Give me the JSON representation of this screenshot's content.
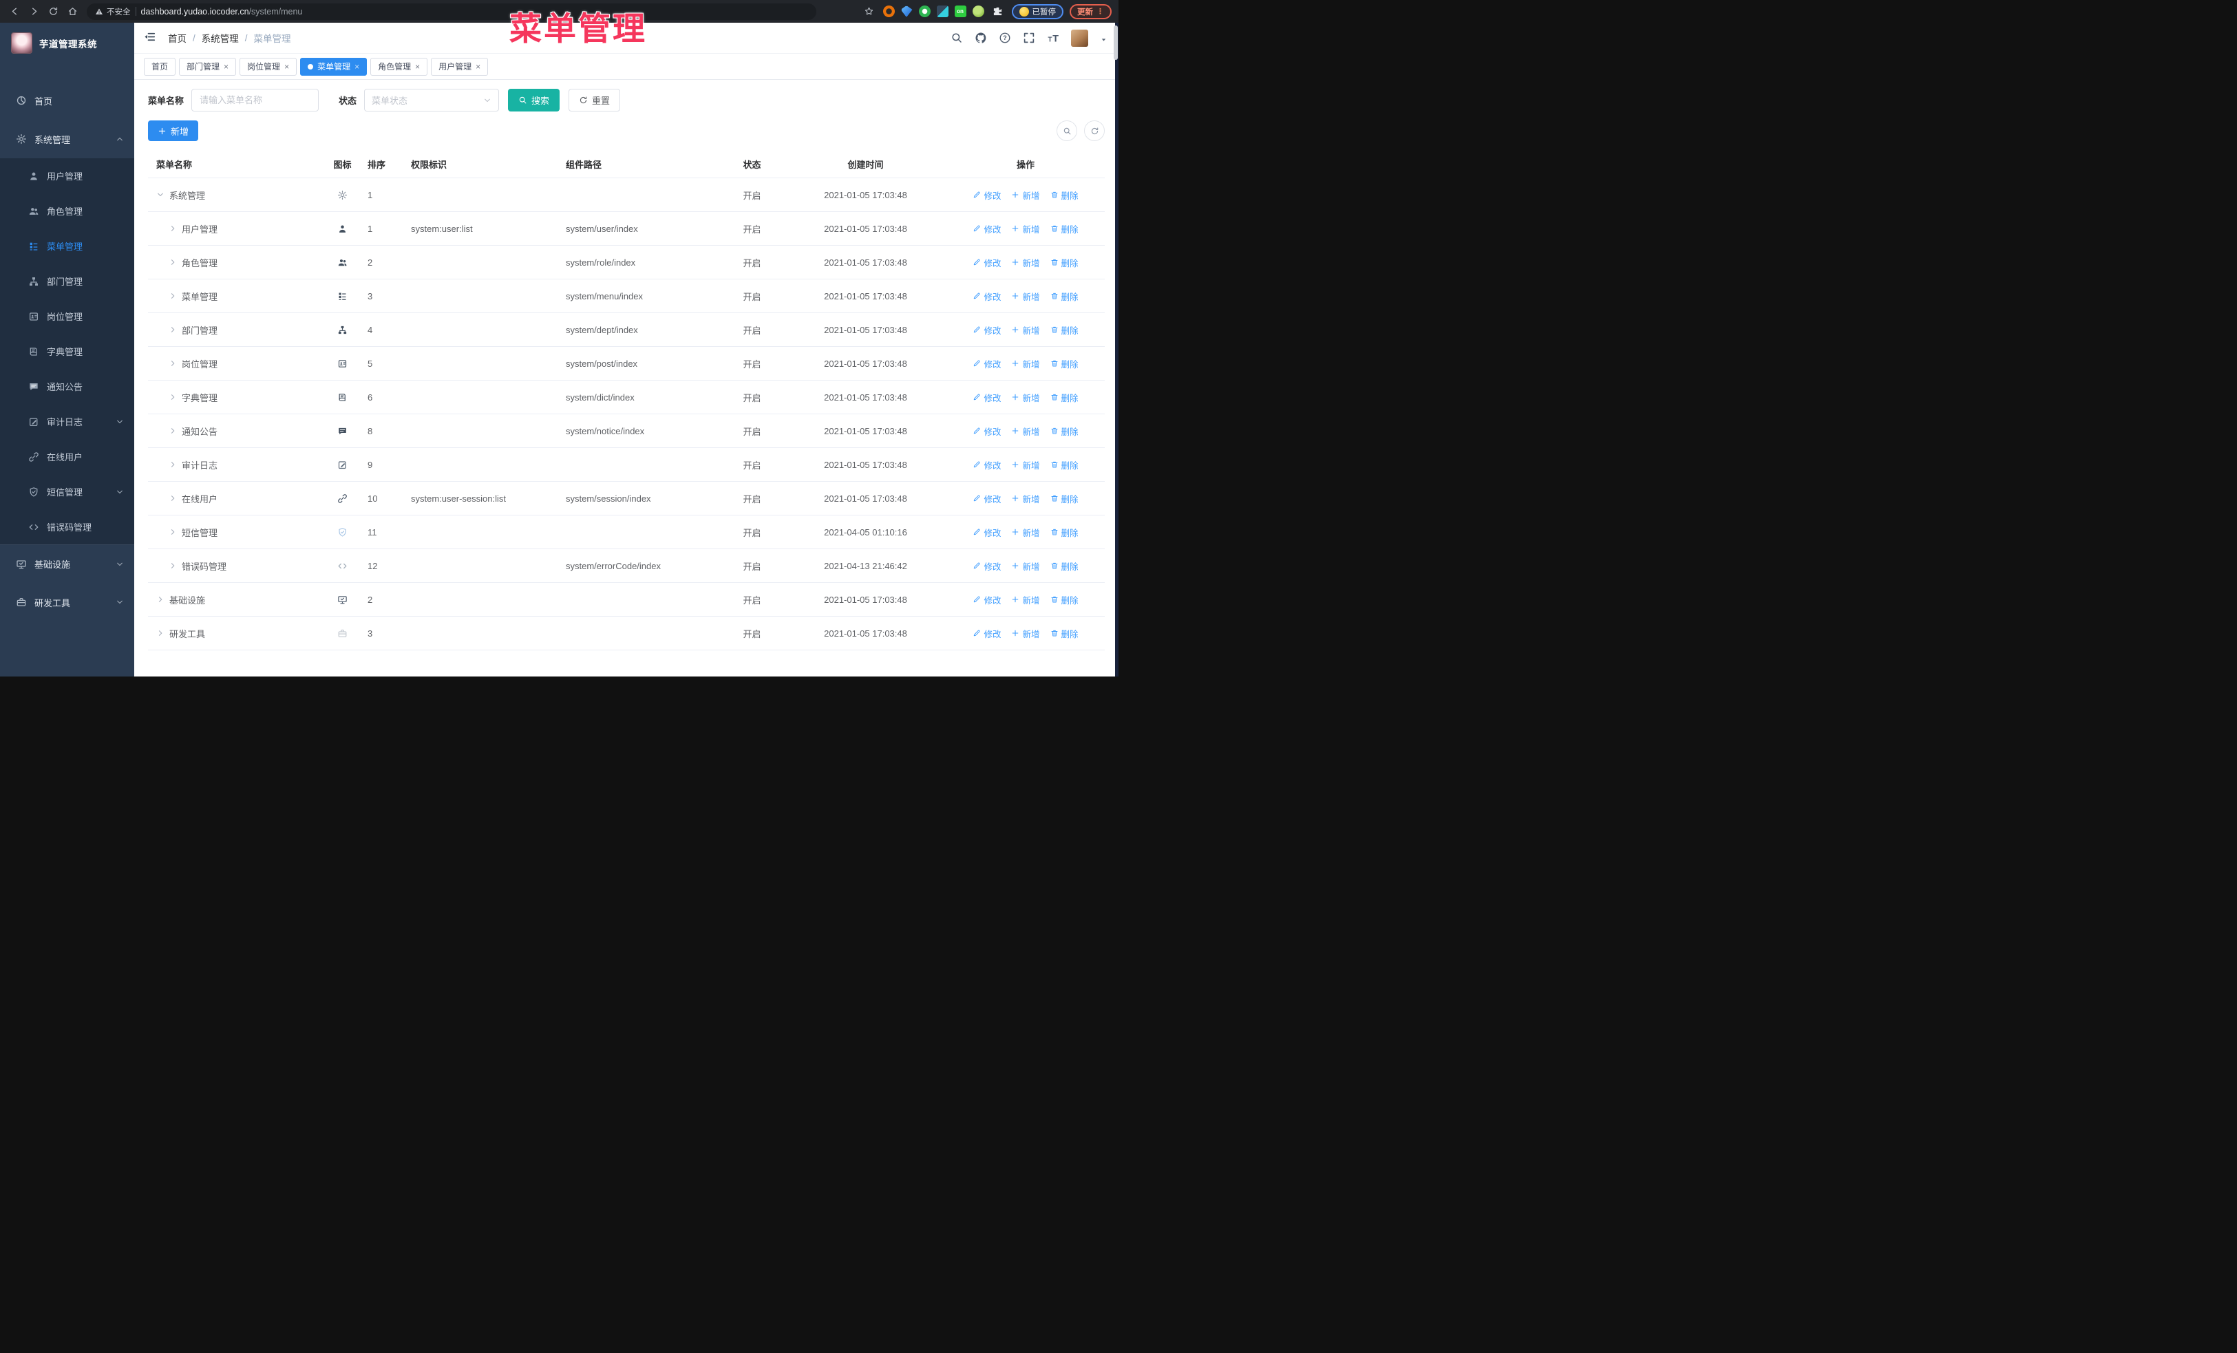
{
  "overlay": {
    "title": "菜单管理"
  },
  "browser": {
    "security_label": "不安全",
    "url_host": "dashboard.yudao.iocoder.cn",
    "url_path": "/system/menu",
    "paused_label": "已暂停",
    "update_label": "更新",
    "update_dots": "⋮"
  },
  "sidebar": {
    "app_title": "芋道管理系统",
    "items": [
      {
        "label": "首页",
        "icon": "#i-dashboard",
        "type": "top"
      },
      {
        "label": "系统管理",
        "icon": "#i-gear",
        "type": "top",
        "chevron": "up"
      },
      {
        "label": "用户管理",
        "icon": "#i-user",
        "type": "sub"
      },
      {
        "label": "角色管理",
        "icon": "#i-users",
        "type": "sub"
      },
      {
        "label": "菜单管理",
        "icon": "#i-menu",
        "type": "sub",
        "active": true
      },
      {
        "label": "部门管理",
        "icon": "#i-tree",
        "type": "sub"
      },
      {
        "label": "岗位管理",
        "icon": "#i-badge",
        "type": "sub"
      },
      {
        "label": "字典管理",
        "icon": "#i-book",
        "type": "sub"
      },
      {
        "label": "通知公告",
        "icon": "#i-message",
        "type": "sub"
      },
      {
        "label": "审计日志",
        "icon": "#i-edit",
        "type": "sub",
        "chevron": "down"
      },
      {
        "label": "在线用户",
        "icon": "#i-link",
        "type": "sub"
      },
      {
        "label": "短信管理",
        "icon": "#i-shield",
        "type": "sub",
        "chevron": "down"
      },
      {
        "label": "错误码管理",
        "icon": "#i-code",
        "type": "sub"
      },
      {
        "label": "基础设施",
        "icon": "#i-monitor",
        "type": "top",
        "chevron": "down",
        "divider": true
      },
      {
        "label": "研发工具",
        "icon": "#i-tool",
        "type": "top",
        "chevron": "down"
      }
    ]
  },
  "header": {
    "breadcrumb": [
      "首页",
      "系统管理",
      "菜单管理"
    ],
    "sep": "/"
  },
  "tabs": {
    "close_glyph": "×",
    "items": [
      {
        "label": "首页",
        "closable": false
      },
      {
        "label": "部门管理",
        "closable": true
      },
      {
        "label": "岗位管理",
        "closable": true
      },
      {
        "label": "菜单管理",
        "closable": true,
        "active": true
      },
      {
        "label": "角色管理",
        "closable": true
      },
      {
        "label": "用户管理",
        "closable": true
      }
    ]
  },
  "filters": {
    "name_label": "菜单名称",
    "name_placeholder": "请输入菜单名称",
    "status_label": "状态",
    "status_placeholder": "菜单状态",
    "search_label": "搜索",
    "reset_label": "重置",
    "add_label": "新增"
  },
  "table": {
    "columns": [
      "菜单名称",
      "图标",
      "排序",
      "权限标识",
      "组件路径",
      "状态",
      "创建时间",
      "操作"
    ],
    "actions": {
      "edit": "修改",
      "add": "新增",
      "delete": "删除"
    },
    "rows": [
      {
        "name": "系统管理",
        "level": 0,
        "caret": "down",
        "icon": "#i-gear",
        "iconColor": "#8a939f",
        "sort": "1",
        "perm": "",
        "path": "",
        "status": "开启",
        "time": "2021-01-05 17:03:48"
      },
      {
        "name": "用户管理",
        "level": 1,
        "caret": "right",
        "icon": "#i-user",
        "iconColor": "#43505f",
        "sort": "1",
        "perm": "system:user:list",
        "path": "system/user/index",
        "status": "开启",
        "time": "2021-01-05 17:03:48"
      },
      {
        "name": "角色管理",
        "level": 1,
        "caret": "right",
        "icon": "#i-users",
        "iconColor": "#43505f",
        "sort": "2",
        "perm": "",
        "path": "system/role/index",
        "status": "开启",
        "time": "2021-01-05 17:03:48"
      },
      {
        "name": "菜单管理",
        "level": 1,
        "caret": "right",
        "icon": "#i-menu",
        "iconColor": "#43505f",
        "sort": "3",
        "perm": "",
        "path": "system/menu/index",
        "status": "开启",
        "time": "2021-01-05 17:03:48"
      },
      {
        "name": "部门管理",
        "level": 1,
        "caret": "right",
        "icon": "#i-tree",
        "iconColor": "#43505f",
        "sort": "4",
        "perm": "",
        "path": "system/dept/index",
        "status": "开启",
        "time": "2021-01-05 17:03:48"
      },
      {
        "name": "岗位管理",
        "level": 1,
        "caret": "right",
        "icon": "#i-badge",
        "iconColor": "#43505f",
        "sort": "5",
        "perm": "",
        "path": "system/post/index",
        "status": "开启",
        "time": "2021-01-05 17:03:48"
      },
      {
        "name": "字典管理",
        "level": 1,
        "caret": "right",
        "icon": "#i-book",
        "iconColor": "#43505f",
        "sort": "6",
        "perm": "",
        "path": "system/dict/index",
        "status": "开启",
        "time": "2021-01-05 17:03:48"
      },
      {
        "name": "通知公告",
        "level": 1,
        "caret": "right",
        "icon": "#i-message",
        "iconColor": "#43505f",
        "sort": "8",
        "perm": "",
        "path": "system/notice/index",
        "status": "开启",
        "time": "2021-01-05 17:03:48"
      },
      {
        "name": "审计日志",
        "level": 1,
        "caret": "right",
        "icon": "#i-edit",
        "iconColor": "#5a6878",
        "sort": "9",
        "perm": "",
        "path": "",
        "status": "开启",
        "time": "2021-01-05 17:03:48"
      },
      {
        "name": "在线用户",
        "level": 1,
        "caret": "right",
        "icon": "#i-link",
        "iconColor": "#4d5a6b",
        "sort": "10",
        "perm": "system:user-session:list",
        "path": "system/session/index",
        "status": "开启",
        "time": "2021-01-05 17:03:48"
      },
      {
        "name": "短信管理",
        "level": 1,
        "caret": "right",
        "icon": "#i-shield",
        "iconColor": "#a8c6e6",
        "sort": "11",
        "perm": "",
        "path": "",
        "status": "开启",
        "time": "2021-04-05 01:10:16"
      },
      {
        "name": "错误码管理",
        "level": 1,
        "caret": "right",
        "icon": "#i-code",
        "iconColor": "#a9b3be",
        "sort": "12",
        "perm": "",
        "path": "system/errorCode/index",
        "status": "开启",
        "time": "2021-04-13 21:46:42"
      },
      {
        "name": "基础设施",
        "level": 0,
        "caret": "right",
        "icon": "#i-monitor",
        "iconColor": "#4d5a6b",
        "sort": "2",
        "perm": "",
        "path": "",
        "status": "开启",
        "time": "2021-01-05 17:03:48"
      },
      {
        "name": "研发工具",
        "level": 0,
        "caret": "right",
        "icon": "#i-tool",
        "iconColor": "#c4cad1",
        "sort": "3",
        "perm": "",
        "path": "",
        "status": "开启",
        "time": "2021-01-05 17:03:48"
      }
    ]
  }
}
